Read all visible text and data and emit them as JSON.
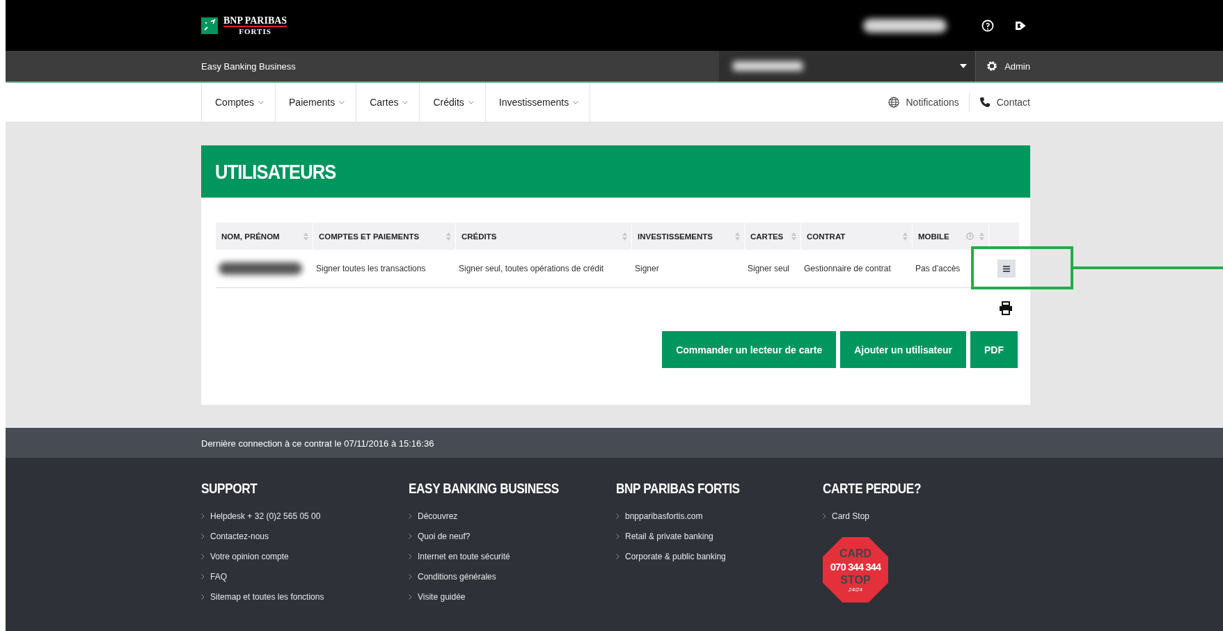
{
  "header": {
    "logo": {
      "line1": "BNP PARIBAS",
      "line2": "FORTIS"
    }
  },
  "subbar": {
    "app_name": "Easy Banking Business",
    "admin": "Admin"
  },
  "nav": {
    "items": [
      {
        "label": "Comptes"
      },
      {
        "label": "Paiements"
      },
      {
        "label": "Cartes"
      },
      {
        "label": "Crédits"
      },
      {
        "label": "Investissements"
      }
    ],
    "links": [
      {
        "kind": "globe",
        "label": "Notifications"
      },
      {
        "kind": "phone",
        "label": "Contact"
      }
    ]
  },
  "panel": {
    "title": "UTILISATEURS",
    "table": {
      "columns": [
        {
          "label": "NOM, PRÉNOM"
        },
        {
          "label": "COMPTES ET PAIEMENTS"
        },
        {
          "label": "CRÉDITS"
        },
        {
          "label": "INVESTISSEMENTS"
        },
        {
          "label": "CARTES"
        },
        {
          "label": "CONTRAT"
        },
        {
          "label": "MOBILE",
          "help": true
        }
      ],
      "rows": [
        {
          "cells": [
            "",
            "Signer toutes les transactions",
            "Signer seul, toutes opérations de crédit",
            "Signer",
            "Signer seul",
            "Gestionnaire de contrat",
            "Pas d'accès"
          ],
          "menu_highlighted": true
        }
      ]
    },
    "buttons": [
      "Commander un lecteur de carte",
      "Ajouter un utilisateur",
      "PDF"
    ]
  },
  "last_login": "Dernière connection à ce contrat le 07/11/2016 à 15:16:36",
  "footer": {
    "columns": [
      {
        "heading": "SUPPORT",
        "links": [
          "Helpdesk + 32 (0)2 565 05 00",
          "Contactez-nous",
          "Votre opinion compte",
          "FAQ",
          "Sitemap et toutes les fonctions"
        ]
      },
      {
        "heading": "EASY BANKING BUSINESS",
        "links": [
          "Découvrez",
          "Quoi de neuf?",
          "Internet en toute sécurité",
          "Conditions générales",
          "Visite guidée"
        ]
      },
      {
        "heading": "BNP PARIBAS FORTIS",
        "links": [
          "bnpparibasfortis.com",
          "Retail & private banking",
          "Corporate & public banking"
        ]
      },
      {
        "heading": "CARTE PERDUE?",
        "links": [
          "Card Stop"
        ],
        "stop_sign": {
          "top": "CARD",
          "number": "070 344 344",
          "bottom": "STOP",
          "hours": "24/24"
        }
      }
    ]
  }
}
